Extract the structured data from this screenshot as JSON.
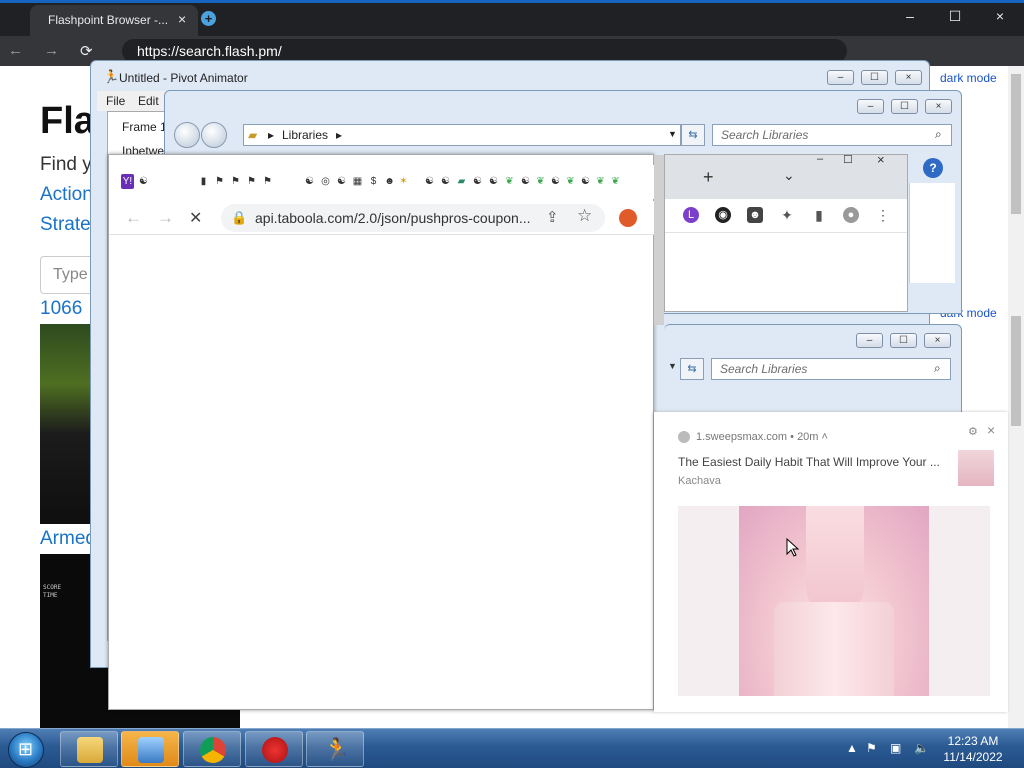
{
  "fp_browser": {
    "tab_title": "Flashpoint Browser -...",
    "url": "https://search.flash.pm/",
    "heading": "Fla",
    "find_text": "Find y",
    "links": [
      "Action",
      "Strate"
    ],
    "search_placeholder": "Type",
    "game_1066": "1066",
    "game_armed": "Armed",
    "game2_score": "SCORE",
    "game2_time": "TIME",
    "dark_mode": "dark mode"
  },
  "pivot": {
    "title": "Untitled - Pivot Animator",
    "menu": [
      "File",
      "Edit"
    ],
    "frame_label": "Frame 1",
    "inbetween_label": "Inbetwe"
  },
  "explorer": {
    "address": "Libraries",
    "search_placeholder": "Search Libraries"
  },
  "chrome_popup": {
    "url": "api.taboola.com/2.0/json/pushpros-coupon..."
  },
  "notification": {
    "source": "1.sweepsmax.com",
    "time": "20m",
    "title": "The Easiest Daily Habit That Will Improve Your ...",
    "subtitle": "Kachava"
  },
  "taskbar": {
    "time": "12:23 AM",
    "date": "11/14/2022"
  },
  "icons": {
    "close": "×",
    "minimize": "–",
    "maximize": "☐",
    "back": "←",
    "forward": "→",
    "reload": "⟳",
    "stop": "✕",
    "lock": "🔒",
    "star": "☆",
    "plus": "+",
    "chevron": "⌄",
    "gear": "⚙"
  }
}
